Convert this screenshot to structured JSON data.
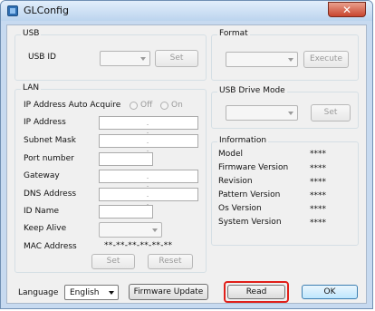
{
  "window": {
    "title": "GLConfig",
    "close_glyph": "✕"
  },
  "usb": {
    "group_label": "USB",
    "id_label": "USB ID",
    "set_label": "Set"
  },
  "format": {
    "group_label": "Format",
    "execute_label": "Execute"
  },
  "lan": {
    "group_label": "LAN",
    "auto_acquire_label": "IP Address Auto Acquire",
    "off_label": "Off",
    "on_label": "On",
    "ip_label": "IP Address",
    "subnet_label": "Subnet Mask",
    "port_label": "Port number",
    "gateway_label": "Gateway",
    "dns_label": "DNS Address",
    "id_name_label": "ID Name",
    "keep_alive_label": "Keep Alive",
    "mac_label": "MAC Address",
    "mac_value": "**-**-**-**-**-**",
    "ip_dots": ". . .",
    "set_label": "Set",
    "reset_label": "Reset"
  },
  "usb_drive": {
    "group_label": "USB Drive Mode",
    "set_label": "Set"
  },
  "information": {
    "group_label": "Information",
    "rows": [
      {
        "label": "Model",
        "value": "****"
      },
      {
        "label": "Firmware Version",
        "value": "****"
      },
      {
        "label": "Revision",
        "value": "****"
      },
      {
        "label": "Pattern Version",
        "value": "****"
      },
      {
        "label": "Os Version",
        "value": "****"
      },
      {
        "label": "System Version",
        "value": "****"
      }
    ]
  },
  "footer": {
    "language_label": "Language",
    "language_value": "English",
    "firmware_update_label": "Firmware Update",
    "read_label": "Read",
    "ok_label": "OK"
  },
  "colors": {
    "highlight": "#e0201a",
    "title_bar": "#bcd4ee",
    "close_button": "#c9452e"
  },
  "icons": {
    "app": "app-icon",
    "close": "close-icon",
    "dropdown": "chevron-down-icon"
  }
}
